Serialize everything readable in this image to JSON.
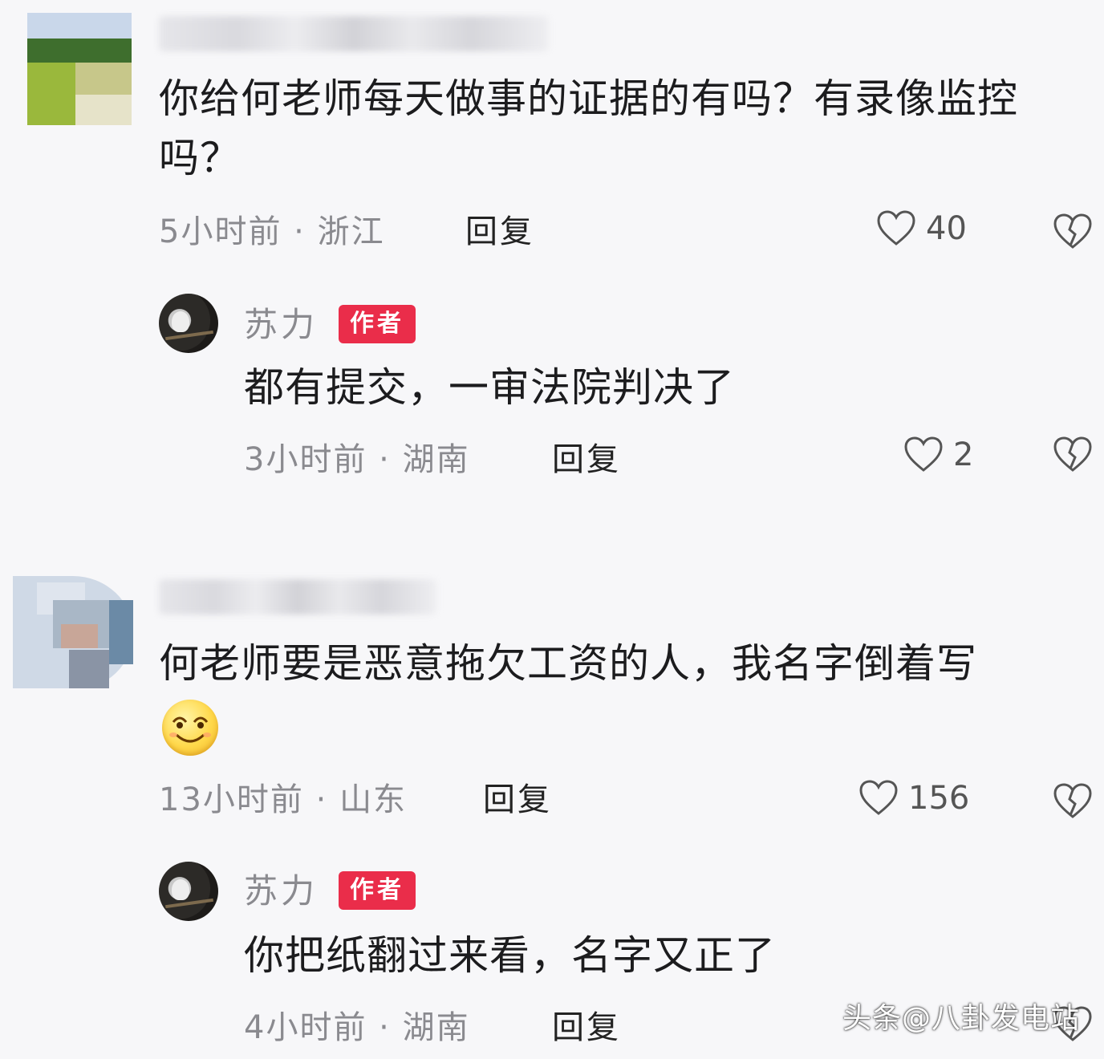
{
  "comments": [
    {
      "text": "你给何老师每天做事的证据的有吗？有录像监控吗？",
      "time": "5小时前",
      "location": "浙江",
      "reply_label": "回复",
      "likes": "40",
      "reply": {
        "author": "苏力",
        "badge": "作者",
        "text": "都有提交，一审法院判决了",
        "time": "3小时前",
        "location": "湖南",
        "reply_label": "回复",
        "likes": "2"
      }
    },
    {
      "text": "何老师要是恶意拖欠工资的人，我名字倒着写",
      "emoji": "smiling-face-emoji",
      "time": "13小时前",
      "location": "山东",
      "reply_label": "回复",
      "likes": "156",
      "reply": {
        "author": "苏力",
        "badge": "作者",
        "text": "你把纸翻过来看，名字又正了",
        "time": "4小时前",
        "location": "湖南",
        "reply_label": "回复"
      }
    }
  ],
  "separator": " · ",
  "watermark": "头条@八卦发电站",
  "icons": {
    "like": "heart-outline-icon",
    "dislike": "broken-heart-icon"
  }
}
